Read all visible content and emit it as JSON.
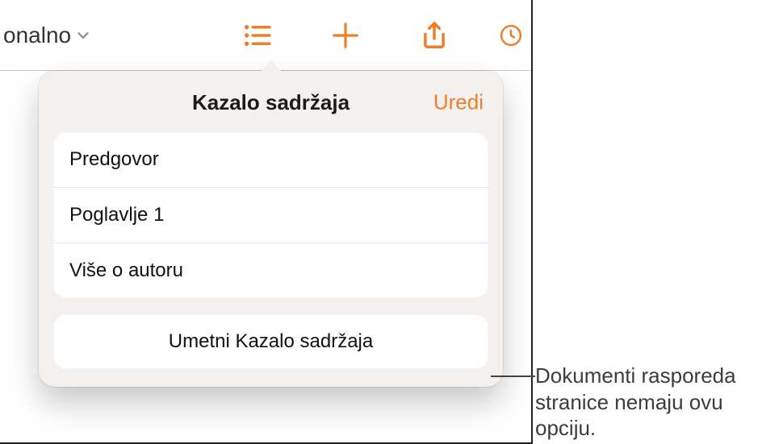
{
  "topbar": {
    "back_label": "onalno"
  },
  "popover": {
    "title": "Kazalo sadržaja",
    "edit": "Uredi",
    "toc": [
      {
        "label": "Predgovor"
      },
      {
        "label": "Poglavlje 1"
      },
      {
        "label": "Više o autoru"
      }
    ],
    "insert_label": "Umetni Kazalo sadržaja"
  },
  "callout": {
    "text": "Dokumenti rasporeda stranice nemaju ovu opciju."
  }
}
